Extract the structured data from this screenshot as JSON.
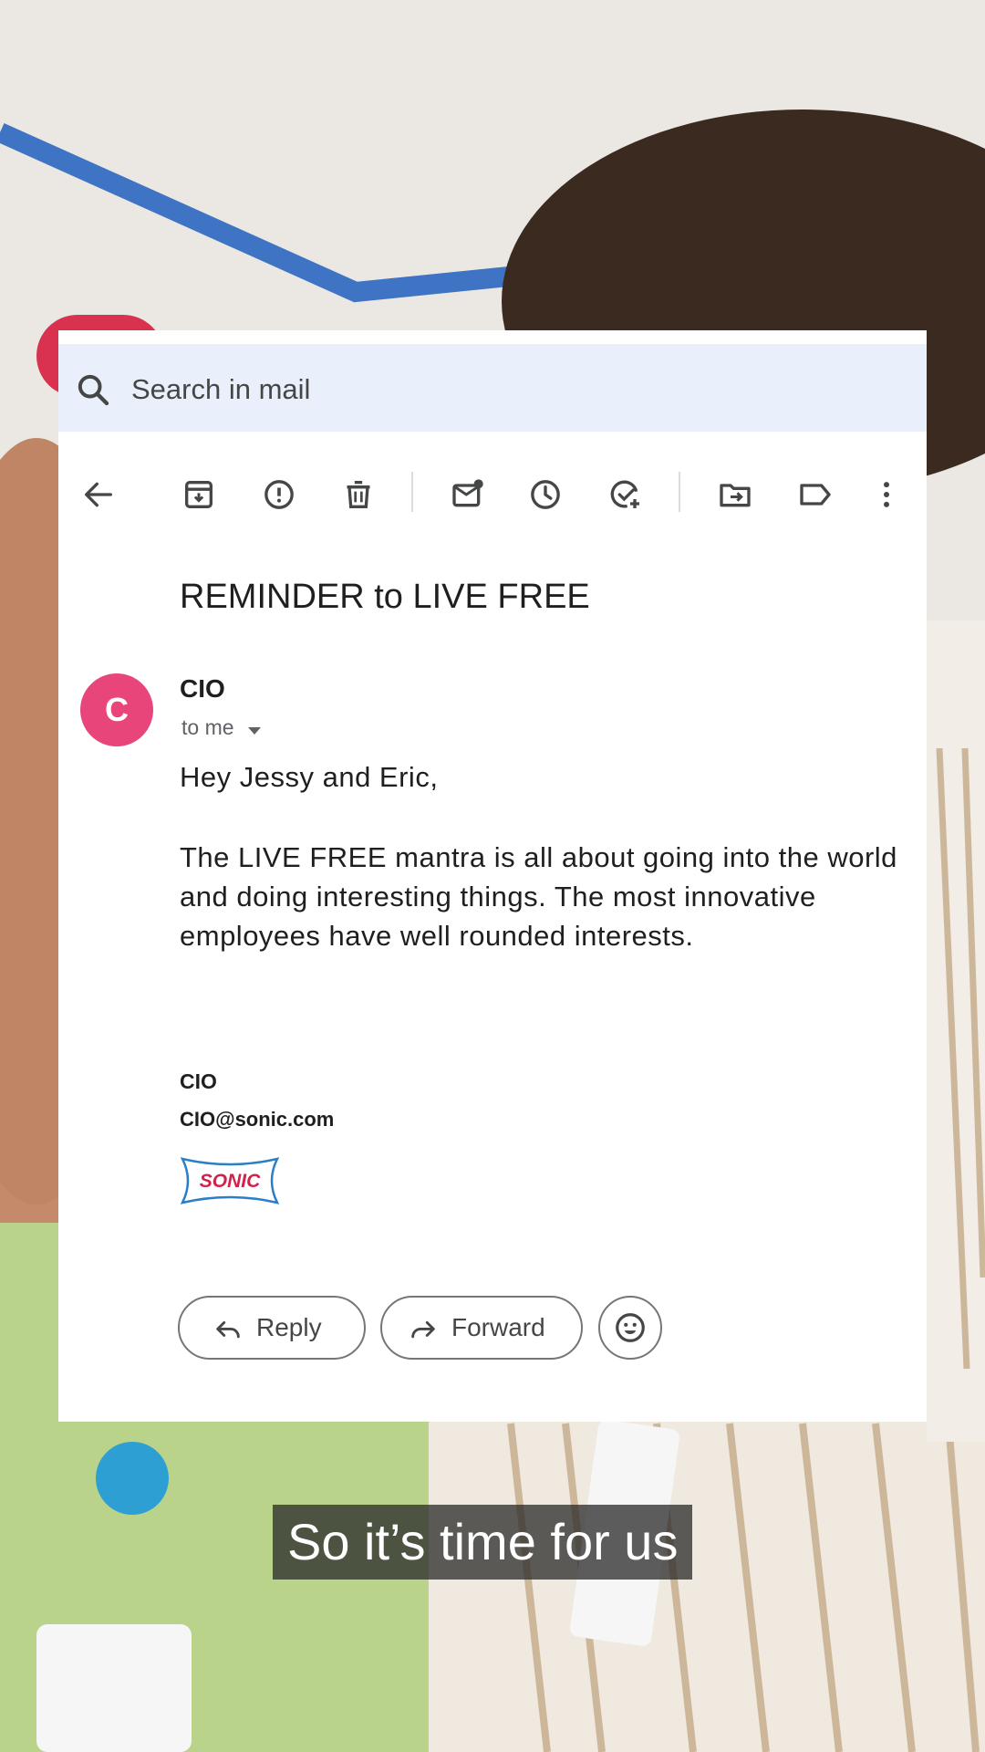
{
  "search": {
    "placeholder": "Search in mail"
  },
  "toolbar": {
    "icons": [
      "back-arrow-icon",
      "archive-icon",
      "report-spam-icon",
      "delete-icon",
      "mark-unread-icon",
      "snooze-icon",
      "add-to-tasks-icon",
      "move-to-icon",
      "label-icon",
      "more-options-icon"
    ]
  },
  "email": {
    "subject": "REMINDER to LIVE FREE",
    "sender": {
      "avatar_letter": "C",
      "name": "CIO",
      "recipient": "to me"
    },
    "greeting": "Hey Jessy and Eric,",
    "body": "The LIVE FREE mantra is all about going into the world and doing interesting things. The most innovative employees have well rounded interests.",
    "signature": {
      "name": "CIO",
      "email": "CIO@sonic.com",
      "logo_text": "SONIC"
    }
  },
  "actions": {
    "reply_label": "Reply",
    "forward_label": "Forward"
  },
  "caption": "So it’s time for us",
  "colors": {
    "avatar": "#e8457a",
    "search_bg": "#eaf0fb",
    "logo_red": "#d4214a",
    "logo_blue": "#2a7fc7"
  }
}
